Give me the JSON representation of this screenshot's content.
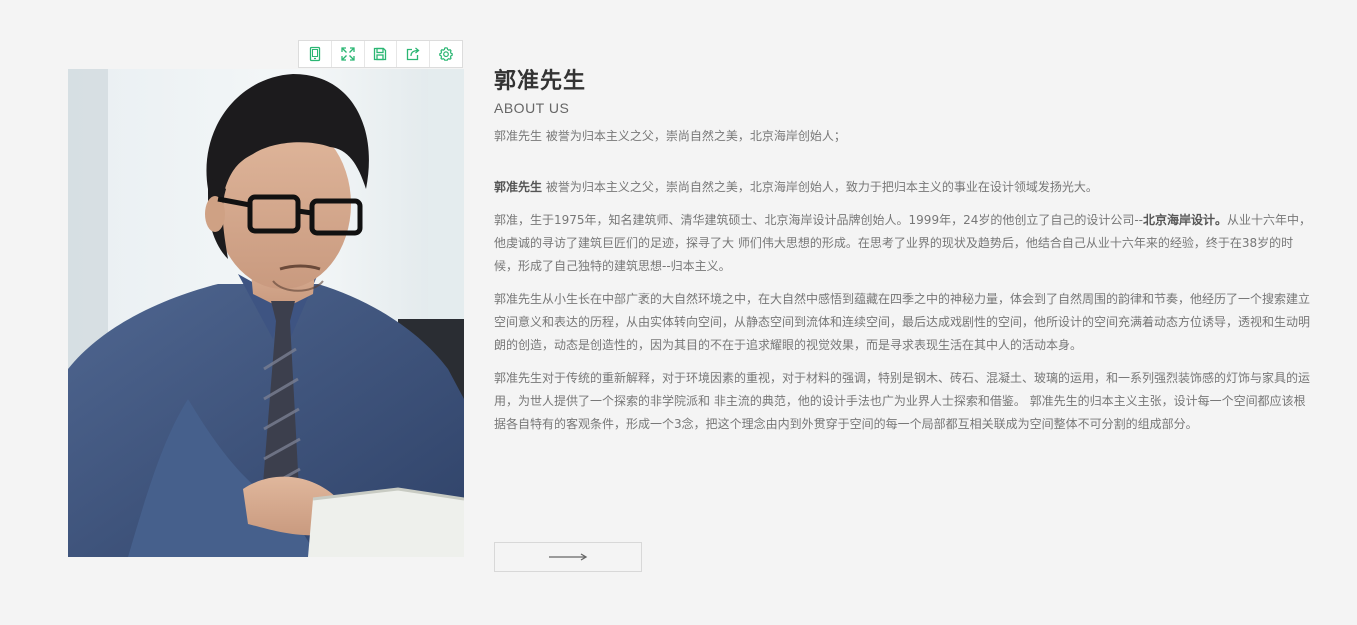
{
  "toolbar": {
    "icons": [
      "tablet-icon",
      "expand-icon",
      "save-icon",
      "share-icon",
      "settings-icon"
    ],
    "accent": "#2bb673"
  },
  "profile": {
    "title": "郭准先生",
    "subtitle": "ABOUT US",
    "intro": "郭准先生 被誉为归本主义之父，崇尚自然之美，北京海岸创始人；",
    "p1_name": "郭准先生",
    "p1_text": " 被誉为归本主义之父，崇尚自然之美，北京海岸创始人，致力于把归本主义的事业在设计领域发扬光大。",
    "p2_before": "郭准，生于1975年，知名建筑师、清华建筑硕士、北京海岸设计品牌创始人。1999年，24岁的他创立了自己的设计公司--",
    "p2_bold": "北京海岸设计。",
    "p2_after": "从业十六年中，他虔诚的寻访了建筑巨匠们的足迹，探寻了大 师们伟大思想的形成。在思考了业界的现状及趋势后，他结合自己从业十六年来的经验，终于在38岁的时候，形成了自己独特的建筑思想--归本主义。",
    "p3": "郭准先生从小生长在中部广袤的大自然环境之中，在大自然中感悟到蕴藏在四季之中的神秘力量，体会到了自然周围的韵律和节奏，他经历了一个搜索建立空间意义和表达的历程，从由实体转向空间，从静态空间到流体和连续空间，最后达成戏剧性的空间，他所设计的空间充满着动态方位诱导，透视和生动明朗的创造，动态是创造性的，因为其目的不在于追求耀眼的视觉效果，而是寻求表现生活在其中人的活动本身。",
    "p4": "郭准先生对于传统的重新解释，对于环境因素的重视，对于材料的强调，特别是钢木、砖石、混凝土、玻璃的运用，和一系列强烈装饰感的灯饰与家具的运用，为世人提供了一个探索的非学院派和 非主流的典范，他的设计手法也广为业界人士探索和借鉴。 郭准先生的归本主义主张，设计每一个空间都应该根据各自特有的客观条件，形成一个3念，把这个理念由内到外贯穿于空间的每一个局部都互相关联成为空间整体不可分割的组成部分。"
  },
  "more_button": {
    "icon": "arrow-right-icon"
  }
}
